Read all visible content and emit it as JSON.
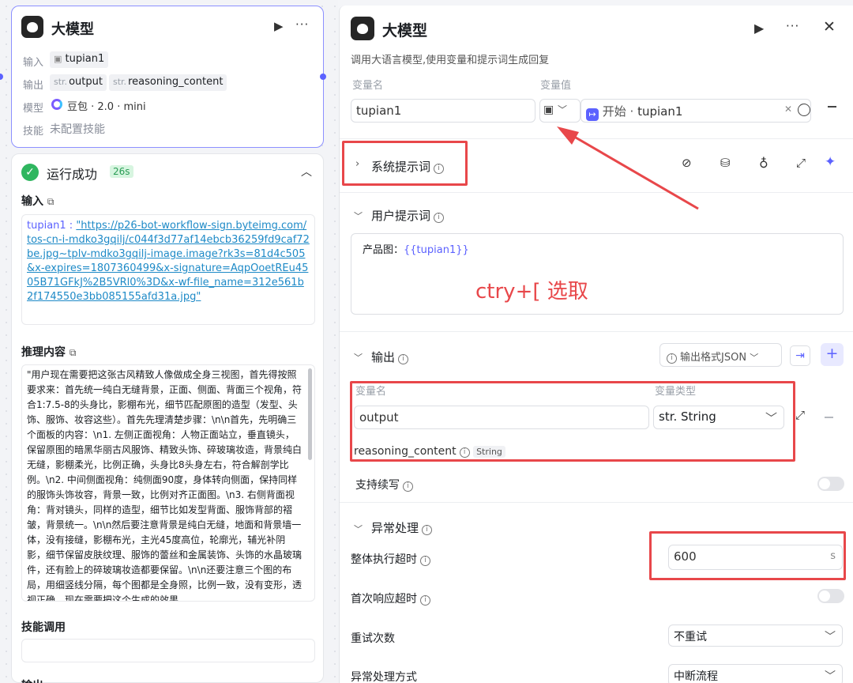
{
  "node": {
    "title": "大模型",
    "input_label": "输入",
    "input_var": "tupian1",
    "output_label": "输出",
    "output_prefix_1": "str.",
    "output_var_1": "output",
    "output_prefix_2": "str.",
    "output_var_2": "reasoning_content",
    "model_label": "模型",
    "model_value": "豆包 · 2.0 · mini",
    "skills_label": "技能",
    "skills_value": "未配置技能"
  },
  "result": {
    "status": "运行成功",
    "duration": "26s",
    "input_title": "输入",
    "input_key": "tupian1 : ",
    "input_url": "\"https://p26-bot-workflow-sign.byteimg.com/tos-cn-i-mdko3gqilj/c044f3d77af14ebcb36259fd9caf72be.jpg~tplv-mdko3gqilj-image.image?rk3s=81d4c505&x-expires=1807360499&x-signature=AqpOoetREu4505B71GFkJ%2B5VRl0%3D&x-wf-file_name=312e561b2f174550e3bb085155afd31a.jpg\"",
    "reasoning_title": "推理内容",
    "reasoning_text": "\"用户现在需要把这张古风精致人像做成全身三视图，首先得按照要求来：首先统一纯白无缝背景，正面、侧面、背面三个视角，符合1:7.5-8的头身比，影棚布光，细节匹配原图的造型（发型、头饰、服饰、妆容这些）。首先先理清楚步骤：\\n\\n首先，先明确三个面板的内容：\\n1. 左侧正面视角：人物正面站立，垂直镜头，保留原图的暗黑华丽古风服饰、精致头饰、碎玻璃妆造，背景纯白无缝，影棚柔光，比例正确，头身比8头身左右，符合解剖学比例。\\n2. 中间侧面视角：纯侧面90度，身体转向侧面，保持同样的服饰头饰妆容，背景一致，比例对齐正面图。\\n3. 右侧背面视角：背对镜头，同样的造型，细节比如发型背面、服饰背部的褶皱，背景统一。\\n\\n然后要注意背景是纯白无缝，地面和背景墙一体，没有接缝，影棚布光，主光45度高位，轮廓光，辅光补阴影，细节保留皮肤纹理、服饰的蕾丝和金属装饰、头饰的水晶玻璃件，还有脸上的碎玻璃妆造都要保留。\\n\\n还要注意三个图的布局，用细竖线分隔，每个图都是全身照，比例一致，没有变形，透视正确。现在需要把这个生成的效果",
    "skills_title": "技能调用",
    "output_title": "输出"
  },
  "panel": {
    "title": "大模型",
    "description": "调用大语言模型,使用变量和提示词生成回复",
    "var_name_header": "变量名",
    "var_value_header": "变量值",
    "var_name": "tupian1",
    "var_ref_prefix": "开始 · ",
    "var_ref": "tupian1",
    "system_prompt_label": "系统提示词",
    "user_prompt_label": "用户提示词",
    "user_prompt_text": "产品图：",
    "user_prompt_var": "{{tupian1}}",
    "annotation": "ctry+[ 选取",
    "output_label": "输出",
    "output_format": "输出格式JSON",
    "out_var_header": "变量名",
    "out_type_header": "变量类型",
    "out_var_name": "output",
    "out_var_type": "str. String",
    "reasoning_name": "reasoning_content",
    "reasoning_type": "String",
    "continue_label": "支持续写",
    "exception_label": "异常处理",
    "timeout_label": "整体执行超时",
    "timeout_value": "600",
    "timeout_unit": "s",
    "first_resp_label": "首次响应超时",
    "retry_label": "重试次数",
    "retry_value": "不重试",
    "handle_label": "异常处理方式",
    "handle_value": "中断流程"
  },
  "colors": {
    "accent": "#5c62ff",
    "annotation_red": "#e8474a",
    "success": "#2fb65f"
  }
}
